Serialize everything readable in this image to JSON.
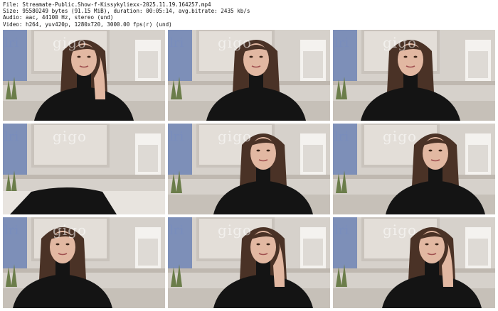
{
  "header": {
    "file_line": "File: Streamate-Public.Show-f-Kissykyliexx-2025.11.19.164257.mp4",
    "size_line": "Size: 95580249 bytes (91.15 MiB), duration: 00:05:14, avg.bitrate: 2435 kb/s",
    "audio_line": "Audio: aac, 44100 Hz, stereo (und)",
    "video_line": "Video: h264, yuv420p, 1280x720, 3000.00 fps(r) (und)"
  },
  "thumbnails": [
    {
      "pose": "hand-on-cheek-left",
      "offset": 0
    },
    {
      "pose": "center",
      "offset": 10
    },
    {
      "pose": "center",
      "offset": -5
    },
    {
      "pose": "empty-dark",
      "offset": 0
    },
    {
      "pose": "head-tilt",
      "offset": 20
    },
    {
      "pose": "close-right",
      "offset": 30
    },
    {
      "pose": "center",
      "offset": -30
    },
    {
      "pose": "hand-on-cheek-right",
      "offset": 20
    },
    {
      "pose": "hand-on-cheek-right",
      "offset": 25
    }
  ],
  "colors": {
    "sweater": "#141414",
    "hair": "#4a3226",
    "skin": "#e2b8a2",
    "wall": "#d6d1cb",
    "window": "#7d8fb8"
  }
}
